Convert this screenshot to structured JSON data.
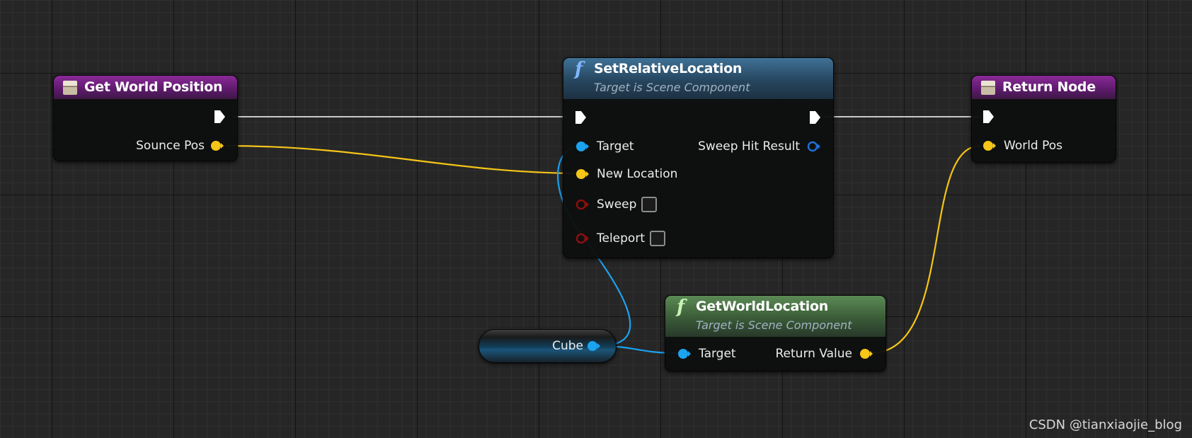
{
  "nodes": {
    "get_world_position": {
      "title": "Get World Position",
      "pins": {
        "out_vector": "Sounce Pos"
      }
    },
    "set_relative_location": {
      "title": "SetRelativeLocation",
      "subtitle": "Target is Scene Component",
      "pins": {
        "target": "Target",
        "new_location": "New Location",
        "sweep": "Sweep",
        "teleport": "Teleport",
        "sweep_hit_result": "Sweep Hit Result"
      },
      "checkboxes": {
        "sweep": false,
        "teleport": false
      }
    },
    "return_node": {
      "title": "Return Node",
      "pins": {
        "world_pos": "World Pos"
      }
    },
    "get_world_location": {
      "title": "GetWorldLocation",
      "subtitle": "Target is Scene Component",
      "pins": {
        "target": "Target",
        "return_value": "Return Value"
      }
    },
    "cube_variable": {
      "label": "Cube"
    }
  },
  "icons": {
    "function": "f-function-icon",
    "struct": "struct-icon",
    "exec": "exec-pin-icon"
  },
  "colors": {
    "exec_wire": "#c8c8c8",
    "vector_pin": "#f5c518",
    "object_pin": "#1ba3f0",
    "struct_pin": "#1f6fd6",
    "bool_pin": "#8c0f0f",
    "function_icon_blue": "#7fb8ff",
    "function_icon_green": "#c8f3b4"
  },
  "watermark": "CSDN @tianxiaojie_blog"
}
